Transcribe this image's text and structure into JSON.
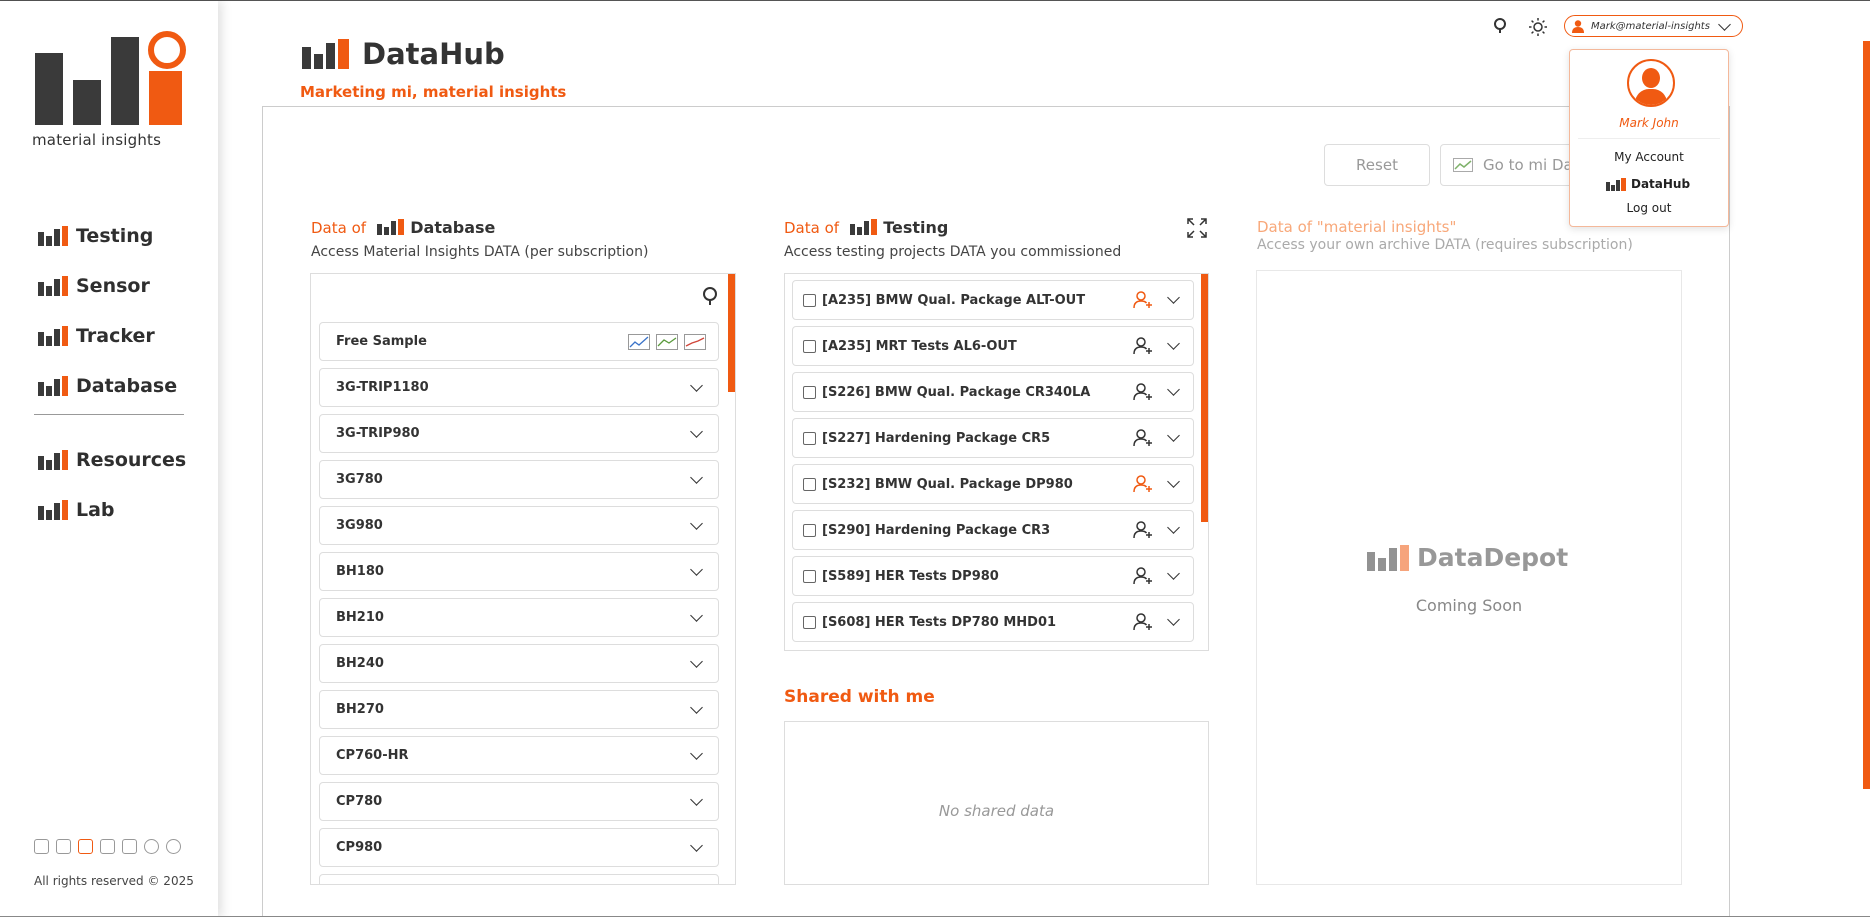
{
  "brand": {
    "name": "material insights"
  },
  "sidebar": {
    "items": [
      {
        "label": "Testing"
      },
      {
        "label": "Sensor"
      },
      {
        "label": "Tracker"
      },
      {
        "label": "Database"
      },
      {
        "label": "Resources"
      },
      {
        "label": "Lab"
      }
    ],
    "social_icons": [
      "building-icon",
      "phone-icon",
      "person-icon",
      "mail-icon",
      "calendar-icon",
      "linkedin-icon",
      "instagram-icon"
    ],
    "copyright": "All rights reserved © 2025"
  },
  "header": {
    "title": "DataHub",
    "subtitle": "Marketing mi, material insights",
    "user_email": "Mark@material-insights"
  },
  "toolbar": {
    "reset_label": "Reset",
    "goto_label": "Go to mi Dat"
  },
  "database_col": {
    "prefix": "Data of",
    "name": "Database",
    "description": "Access Material Insights DATA (per subscription)",
    "free_sample": "Free Sample",
    "items": [
      "3G-TRIP1180",
      "3G-TRIP980",
      "3G780",
      "3G980",
      "BH180",
      "BH210",
      "BH240",
      "BH270",
      "CP760-HR",
      "CP780",
      "CP980"
    ]
  },
  "testing_col": {
    "prefix": "Data of",
    "name": "Testing",
    "description": "Access testing projects DATA you commissioned",
    "projects": [
      {
        "label": "[A235] BMW Qual. Package ALT-OUT",
        "shared": true
      },
      {
        "label": "[A235] MRT Tests AL6-OUT",
        "shared": false
      },
      {
        "label": "[S226] BMW Qual. Package CR340LA",
        "shared": false
      },
      {
        "label": "[S227] Hardening Package CR5",
        "shared": false
      },
      {
        "label": "[S232] BMW Qual. Package DP980",
        "shared": true
      },
      {
        "label": "[S290] Hardening Package CR3",
        "shared": false
      },
      {
        "label": "[S589] HER Tests DP980",
        "shared": false
      },
      {
        "label": "[S608] HER Tests DP780 MHD01",
        "shared": false
      }
    ],
    "shared_title": "Shared with me",
    "no_shared": "No shared data"
  },
  "archive_col": {
    "title": "Data of \"material insights\"",
    "description": "Access your own archive DATA (requires subscription)",
    "depot_name": "DataDepot",
    "depot_status": "Coming Soon"
  },
  "user_menu": {
    "name": "Mark John",
    "my_account": "My Account",
    "datahub": "DataHub",
    "logout": "Log out"
  },
  "colors": {
    "accent": "#f05a12",
    "dark": "#333333"
  }
}
